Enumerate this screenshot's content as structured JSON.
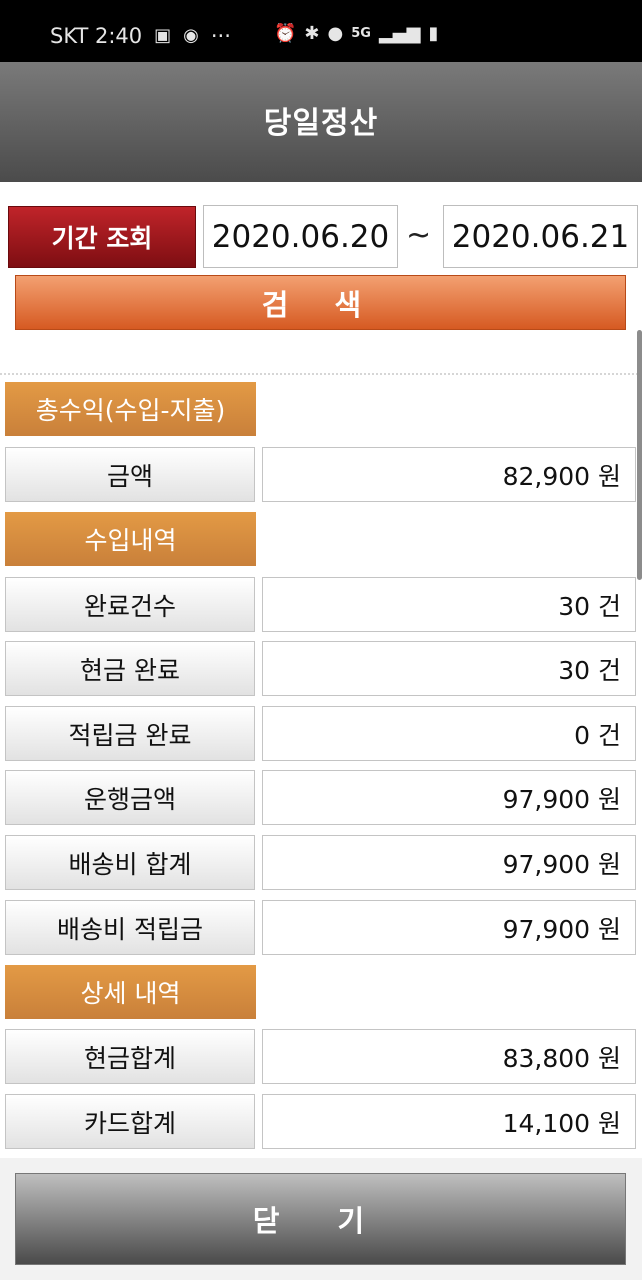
{
  "status_bar": {
    "carrier_time": "SKT 2:40",
    "ellipsis": "···",
    "icons_left": [
      "image-icon",
      "car-icon"
    ],
    "icons_right": [
      "alarm-icon",
      "bluetooth-icon",
      "location-icon",
      "5g-icon",
      "signal-icon",
      "battery-icon"
    ],
    "network": "5G"
  },
  "header": {
    "title": "당일정산"
  },
  "period": {
    "label": "기간 조회",
    "start_date": "2020.06.20",
    "separator": "~",
    "end_date": "2020.06.21"
  },
  "search_button": "검 색",
  "sections": {
    "total": {
      "title": "총수익(수입-지출)",
      "rows": [
        {
          "label": "금액",
          "value": "82,900 원"
        }
      ]
    },
    "income": {
      "title": "수입내역",
      "rows": [
        {
          "label": "완료건수",
          "value": "30 건"
        },
        {
          "label": "현금 완료",
          "value": "30 건"
        },
        {
          "label": "적립금 완료",
          "value": "0 건"
        },
        {
          "label": "운행금액",
          "value": "97,900 원"
        },
        {
          "label": "배송비 합계",
          "value": "97,900 원"
        },
        {
          "label": "배송비 적립금",
          "value": "97,900 원"
        }
      ]
    },
    "detail": {
      "title": "상세 내역",
      "rows": [
        {
          "label": "현금합계",
          "value": "83,800 원"
        },
        {
          "label": "카드합계",
          "value": "14,100 원"
        }
      ]
    }
  },
  "close_button": "닫 기",
  "colors": {
    "period_label": "#9b1419",
    "search_button": "#e0702f",
    "section_label": "#d68c40",
    "header": "#5f5f5f"
  }
}
